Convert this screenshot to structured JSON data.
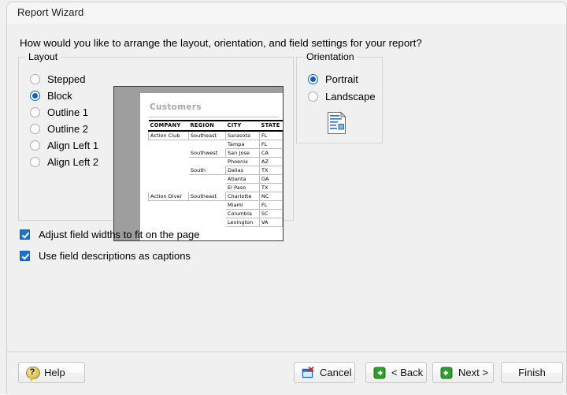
{
  "window": {
    "title": "Report Wizard"
  },
  "prompt": "How would you like to arrange the layout, orientation, and field settings for your report?",
  "layout_group": {
    "legend": "Layout",
    "options": [
      {
        "label": "Stepped",
        "selected": false
      },
      {
        "label": "Block",
        "selected": true
      },
      {
        "label": "Outline 1",
        "selected": false
      },
      {
        "label": "Outline 2",
        "selected": false
      },
      {
        "label": "Align Left 1",
        "selected": false
      },
      {
        "label": "Align Left 2",
        "selected": false
      }
    ]
  },
  "orientation_group": {
    "legend": "Orientation",
    "options": [
      {
        "label": "Portrait",
        "selected": true
      },
      {
        "label": "Landscape",
        "selected": false
      }
    ],
    "icon": "document-page-icon"
  },
  "preview": {
    "report_title": "Customers",
    "columns": [
      "COMPANY",
      "REGION",
      "CITY",
      "STATE"
    ],
    "rows": [
      {
        "company": "Action Club",
        "region": "Southeast",
        "city": "Sarasota",
        "state": "FL"
      },
      {
        "company": "",
        "region": "",
        "city": "Tampa",
        "state": "FL"
      },
      {
        "company": "",
        "region": "Southwest",
        "city": "San Jose",
        "state": "CA"
      },
      {
        "company": "",
        "region": "",
        "city": "Phoenix",
        "state": "AZ"
      },
      {
        "company": "",
        "region": "South",
        "city": "Dallas",
        "state": "TX"
      },
      {
        "company": "",
        "region": "",
        "city": "Atlanta",
        "state": "GA"
      },
      {
        "company": "",
        "region": "",
        "city": "El Paso",
        "state": "TX"
      },
      {
        "company": "Action Diver",
        "region": "Southeast",
        "city": "Charlotte",
        "state": "NC"
      },
      {
        "company": "",
        "region": "",
        "city": "Miami",
        "state": "FL"
      },
      {
        "company": "",
        "region": "",
        "city": "Columbia",
        "state": "SC"
      },
      {
        "company": "",
        "region": "",
        "city": "Lexington",
        "state": "VA"
      }
    ]
  },
  "checkboxes": [
    {
      "label": "Adjust field widths to fit on the page",
      "checked": true
    },
    {
      "label": "Use field descriptions as captions",
      "checked": true
    }
  ],
  "footer": {
    "help": "Help",
    "cancel": "Cancel",
    "back": "< Back",
    "next": "Next >",
    "finish": "Finish"
  },
  "colors": {
    "accent_blue": "#1b72d0",
    "radio_blue": "#0a63c9",
    "green_nav": "#2f9e2f",
    "cancel_red": "#d42020",
    "preview_gray": "#9e9e9e"
  }
}
